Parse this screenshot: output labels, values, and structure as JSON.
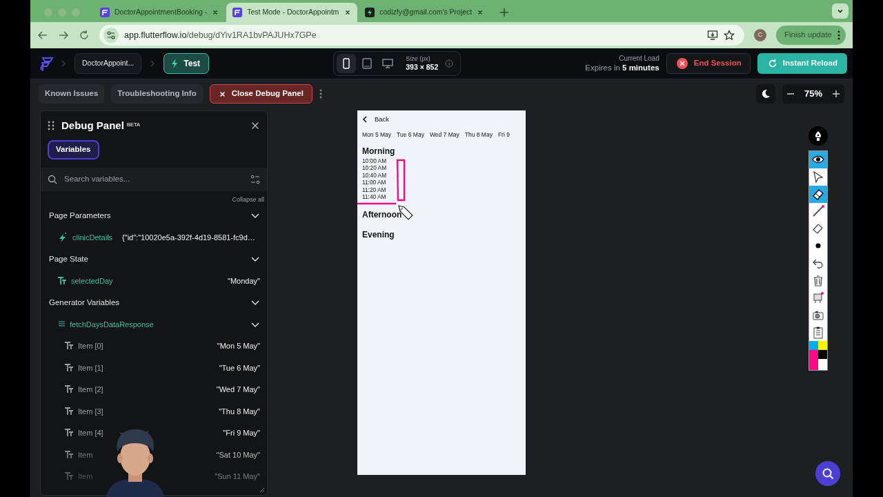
{
  "browser": {
    "tabs": [
      {
        "title": "DoctorAppointmentBooking -",
        "kind": "flutterflow",
        "selected": false
      },
      {
        "title": "Test Mode - DoctorAppointm",
        "kind": "flutterflow",
        "selected": true
      },
      {
        "title": "codizfy@gmail.com's Project",
        "kind": "bolt",
        "selected": false
      }
    ],
    "url_host": "app.flutterflow.io",
    "url_path": "/debug/dYiv1RA1bvPAJUHx7GPe",
    "profile_initial": "C",
    "update_button": "Finish update"
  },
  "header": {
    "project": "DoctorAppoint...",
    "mode": "Test",
    "devices": [
      {
        "kind": "phone",
        "selected": true
      },
      {
        "kind": "tablet",
        "selected": false
      },
      {
        "kind": "desktop",
        "selected": false
      }
    ],
    "size_label": "Size (px)",
    "size": "393 × 852",
    "load_label": "Current Load",
    "expires_prefix": "Expires in",
    "expires_value": "5 minutes",
    "end_session": "End Session",
    "instant_reload": "Instant Reload"
  },
  "toolbar": {
    "buttons": [
      {
        "label": "Known Issues",
        "kind": "plain"
      },
      {
        "label": "Troubleshooting Info",
        "kind": "plain"
      },
      {
        "label": "Close Debug Panel",
        "kind": "danger"
      }
    ],
    "zoom": "75%"
  },
  "debug_panel": {
    "title": "Debug Panel",
    "badge": "BETA",
    "tabs": [
      {
        "label": "Variables",
        "selected": true
      }
    ],
    "search_placeholder": "Search variables...",
    "collapse_all": "Collapse all",
    "sections": [
      {
        "title": "Page Parameters",
        "expanded": true,
        "items": [
          {
            "kind": "param",
            "name": "clinicDetails",
            "value": "{\"id\":\"10020e5a-392f-4d19-8581-fc9d…"
          }
        ]
      },
      {
        "title": "Page State",
        "expanded": true,
        "items": [
          {
            "kind": "text",
            "name": "selectedDay",
            "value": "\"Monday\""
          }
        ]
      },
      {
        "title": "Generator Variables",
        "expanded": true,
        "items": [
          {
            "kind": "list",
            "name": "fetchDaysDataResponse",
            "expanded": true,
            "children": [
              {
                "kind": "text",
                "name": "Item [0]",
                "value": "\"Mon 5 May\""
              },
              {
                "kind": "text",
                "name": "Item [1]",
                "value": "\"Tue 6 May\""
              },
              {
                "kind": "text",
                "name": "Item [2]",
                "value": "\"Wed 7 May\""
              },
              {
                "kind": "text",
                "name": "Item [3]",
                "value": "\"Thu 8 May\""
              },
              {
                "kind": "text",
                "name": "Item [4]",
                "value": "\"Fri 9 May\""
              },
              {
                "kind": "text",
                "name": "Item",
                "value": "\"Sat 10 May\""
              },
              {
                "kind": "text",
                "name": "Item",
                "value": "\"Sun 11 May\""
              }
            ]
          }
        ]
      }
    ]
  },
  "preview": {
    "back": "Back",
    "days": [
      "Mon 5 May",
      "Tue 6 May",
      "Wed 7 May",
      "Thu 8 May",
      "Fri 9"
    ],
    "periods": [
      {
        "title": "Morning",
        "slots": [
          "10:00 AM",
          "10:20 AM",
          "10:40 AM",
          "11:00 AM",
          "11:20 AM",
          "11:40 AM"
        ]
      },
      {
        "title": "Afternoon"
      },
      {
        "title": "Evening"
      }
    ]
  },
  "annotation_tools": [
    {
      "kind": "eye",
      "selected": true
    },
    {
      "kind": "pointer",
      "selected": false
    },
    {
      "kind": "marker",
      "selected": true
    },
    {
      "kind": "pen",
      "selected": false
    },
    {
      "kind": "eraser",
      "selected": false
    },
    {
      "kind": "dot",
      "selected": false
    },
    {
      "kind": "undo",
      "selected": false
    },
    {
      "kind": "trash",
      "selected": false
    },
    {
      "kind": "screen",
      "selected": false
    },
    {
      "kind": "camera",
      "selected": false
    },
    {
      "kind": "clipboard",
      "selected": false
    }
  ],
  "palette": [
    {
      "color": "#00aeef"
    },
    {
      "color": "#fff200"
    },
    {
      "color": "#ff0a84"
    },
    {
      "color": "#000000"
    }
  ]
}
